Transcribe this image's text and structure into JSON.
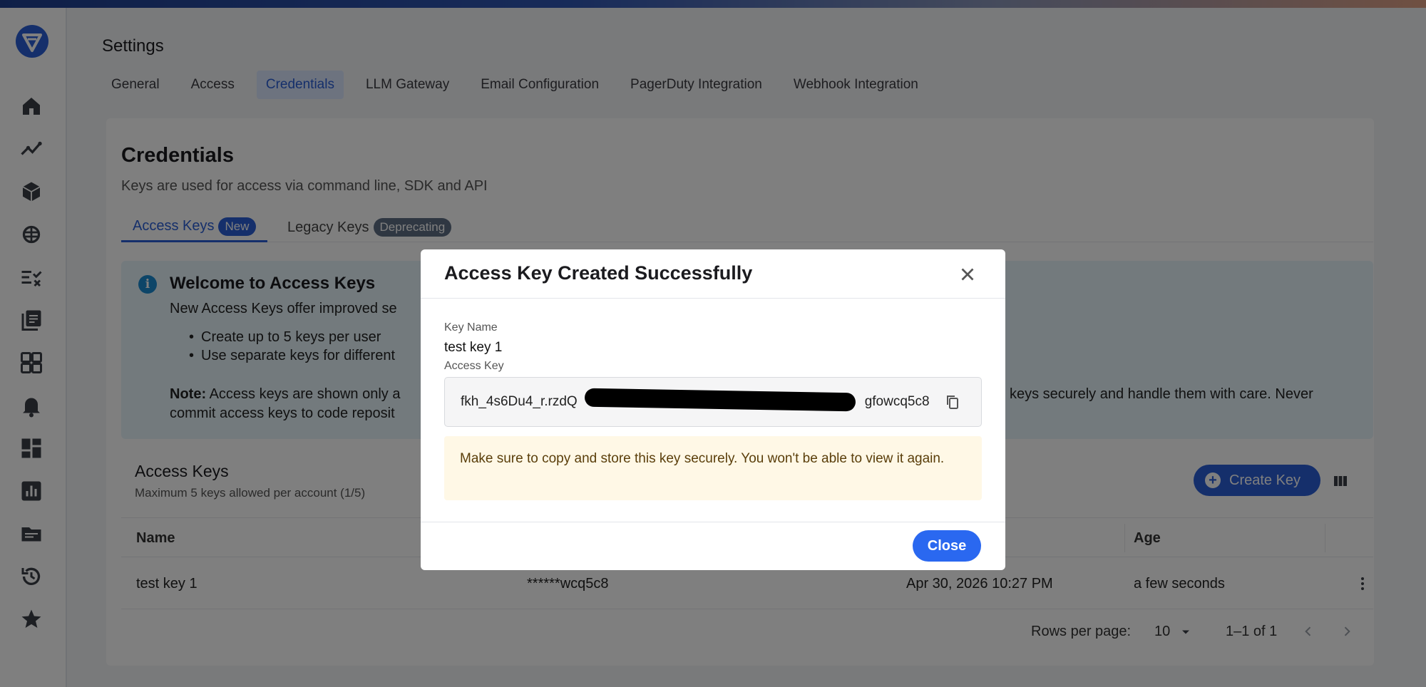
{
  "page": {
    "title": "Settings",
    "tabs": [
      "General",
      "Access",
      "Credentials",
      "LLM Gateway",
      "Email Configuration",
      "PagerDuty Integration",
      "Webhook Integration"
    ],
    "active_tab": "Credentials"
  },
  "sidebar": {
    "icons": [
      "home-icon",
      "analytics-icon",
      "cube-icon",
      "brain-icon",
      "checklist-icon",
      "library-icon",
      "apps-icon",
      "bell-icon",
      "dashboard-icon",
      "bar-chart-icon",
      "folder-icon",
      "history-icon",
      "star-icon"
    ]
  },
  "credentials": {
    "title": "Credentials",
    "subtitle": "Keys are used for access via command line, SDK and API",
    "tabs": {
      "access_keys": "Access Keys",
      "access_keys_badge": "New",
      "legacy_keys": "Legacy Keys",
      "legacy_keys_badge": "Deprecating"
    },
    "info": {
      "title": "Welcome to Access Keys",
      "lead": "New Access Keys offer improved se",
      "bullets": [
        "Create up to 5 keys per user",
        "Use separate keys for different"
      ],
      "note_label": "Note:",
      "note_text": "Access keys are shown only a",
      "note_tail": "keys securely and handle them with care. Never",
      "note_line2": "commit access keys to code reposit"
    },
    "table": {
      "title": "Access Keys",
      "subtitle": "Maximum 5 keys allowed per account (1/5)",
      "create_label": "Create Key",
      "headers": {
        "name": "Name",
        "age": "Age"
      },
      "row": {
        "name": "test key 1",
        "key": "******wcq5c8",
        "created": "Apr 30, 2026 10:27 PM",
        "age": "a few seconds"
      },
      "pagination": {
        "rows_label": "Rows per page:",
        "rows_value": "10",
        "range": "1–1 of 1"
      }
    }
  },
  "modal": {
    "title": "Access Key Created Successfully",
    "key_name_label": "Key Name",
    "key_name_value": "test key 1",
    "access_key_label": "Access Key",
    "access_key_prefix": "fkh_4s6Du4_r.rzdQ",
    "access_key_suffix": "gfowcq5c8",
    "warning": "Make sure to copy and store this key securely. You won't be able to view it again.",
    "close_label": "Close"
  },
  "colors": {
    "accent": "#2a5fd6",
    "info_bg": "#e6f4fb",
    "warn_bg": "#fff8e6"
  }
}
